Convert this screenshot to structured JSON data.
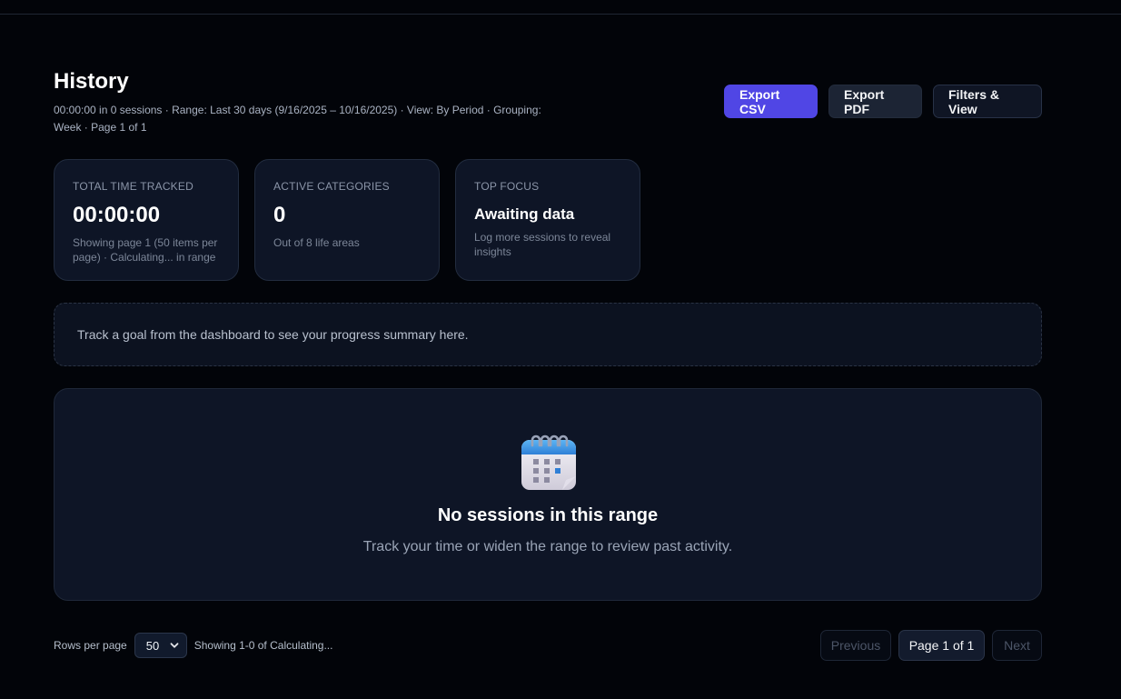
{
  "header": {
    "title": "History",
    "subtitle": "00:00:00 in 0 sessions · Range: Last 30 days (9/16/2025 – 10/16/2025) · View: By Period · Grouping: Week · Page 1 of 1",
    "export_csv": "Export CSV",
    "export_pdf": "Export PDF",
    "filters": "Filters & View"
  },
  "stats": [
    {
      "label": "TOTAL TIME TRACKED",
      "value": "00:00:00",
      "note": "Showing page 1 (50 items per page) · Calculating... in range"
    },
    {
      "label": "ACTIVE CATEGORIES",
      "value": "0",
      "note": "Out of 8 life areas"
    },
    {
      "label": "TOP FOCUS",
      "value": "Awaiting data",
      "note": "Log more sessions to reveal insights"
    }
  ],
  "goal_banner": "Track a goal from the dashboard to see your progress summary here.",
  "empty_state": {
    "icon": "calendar-icon",
    "title": "No sessions in this range",
    "description": "Track your time or widen the range to review past activity."
  },
  "footer": {
    "rows_label": "Rows per page",
    "rows_value": "50",
    "showing": "Showing 1-0 of Calculating...",
    "previous": "Previous",
    "current_page": "Page 1 of 1",
    "next": "Next"
  },
  "colors": {
    "background": "#020409",
    "card": "#0e1526",
    "accent": "#5046e5"
  }
}
